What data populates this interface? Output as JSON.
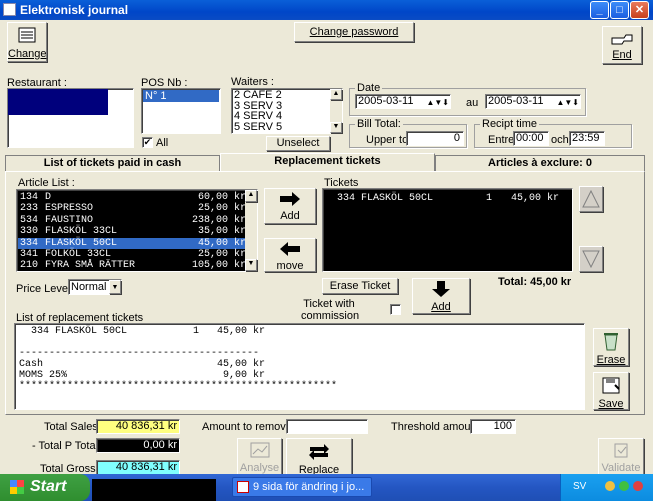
{
  "window": {
    "title": "Elektronisk journal"
  },
  "toolbar": {
    "change_label": "Change",
    "change_password_label": "Change password",
    "end_label": "End"
  },
  "restaurant": {
    "label": "Restaurant :"
  },
  "pos": {
    "label": "POS Nb :",
    "items": [
      "N° 1"
    ],
    "all_label": "All"
  },
  "waiters": {
    "label": "Waiters :",
    "items": [
      "2 CAFE 2",
      "3 SERV 3",
      "4 SERV 4",
      "5 SERV 5"
    ],
    "unselect_label": "Unselect"
  },
  "date": {
    "label": "Date",
    "from": "2005-03-11",
    "to_label": "au",
    "to": "2005-03-11"
  },
  "bill_total": {
    "label": "Bill Total:",
    "upper_label": "Upper to",
    "upper_value": "0"
  },
  "receipt_time": {
    "label": "Recipt time",
    "start_label": "Entre",
    "start": "00:00",
    "and_label": "och",
    "end": "23:59"
  },
  "tabs": [
    {
      "label": "List of tickets paid in cash"
    },
    {
      "label": "Replacement tickets"
    },
    {
      "label": "Articles à exclure: 0"
    }
  ],
  "article_list": {
    "label": "Article List :",
    "rows": [
      {
        "code": "134",
        "name": "D",
        "price": "60,00 kr"
      },
      {
        "code": "233",
        "name": "ESPRESSO",
        "price": "25,00 kr"
      },
      {
        "code": "534",
        "name": "FAUSTINO",
        "price": "238,00 kr"
      },
      {
        "code": "330",
        "name": "FLASKÖL 33CL",
        "price": "35,00 kr"
      },
      {
        "code": "334",
        "name": "FLASKÖL 50CL",
        "price": "45,00 kr"
      },
      {
        "code": "341",
        "name": "FOLKÖL 33CL",
        "price": "25,00 kr"
      },
      {
        "code": "210",
        "name": "FYRA SMÅ RÄTTER",
        "price": "105,00 kr"
      }
    ],
    "selected_index": 4
  },
  "actions": {
    "add_label": "Add",
    "move_label": "move",
    "erase_ticket_label": "Erase Ticket",
    "add_ticket_label": "Add"
  },
  "tickets": {
    "label": "Tickets",
    "rows": [
      {
        "code": "334",
        "name": "FLASKÖL 50CL",
        "qty": "1",
        "price": "45,00 kr"
      }
    ],
    "total": "Total: 45,00 kr"
  },
  "price_level": {
    "label": "Price Level :",
    "value": "Normal"
  },
  "ticket_commission": {
    "label_1": "Ticket with",
    "label_2": "commission"
  },
  "replacement": {
    "label": "List of replacement tickets",
    "lines": [
      "  334 FLASKÖL 50CL           1   45,00 kr",
      "",
      "----------------------------------------",
      "Cash                             45,00 kr",
      "MOMS 25%                          9,00 kr",
      "*****************************************************"
    ]
  },
  "side_buttons": {
    "erase_label": "Erase",
    "save_label": "Save"
  },
  "totals": {
    "total_sales_label": "Total Sales :",
    "total_sales": "40 836,31 kr",
    "total_p_label": "- Total P Total:",
    "total_p": "0,00 kr",
    "total_gross_label": "Total Gross :",
    "total_gross": "40 836,31 kr",
    "amount_remove_label": "Amount to remove :",
    "amount_remove": "",
    "threshold_label": "Threshold amount:",
    "threshold": "100"
  },
  "bottom_buttons": {
    "analyse_label": "Analyse",
    "replace_label": "Replace auto",
    "validate_label": "Validate"
  },
  "taskbar": {
    "start_label": "Start",
    "task_label": "9 sida för ändring i jo...",
    "lang": "SV"
  },
  "colors": {
    "highlight_yellow": "#ffff80",
    "highlight_cyan": "#80ffff",
    "selection": "#316ac5"
  }
}
